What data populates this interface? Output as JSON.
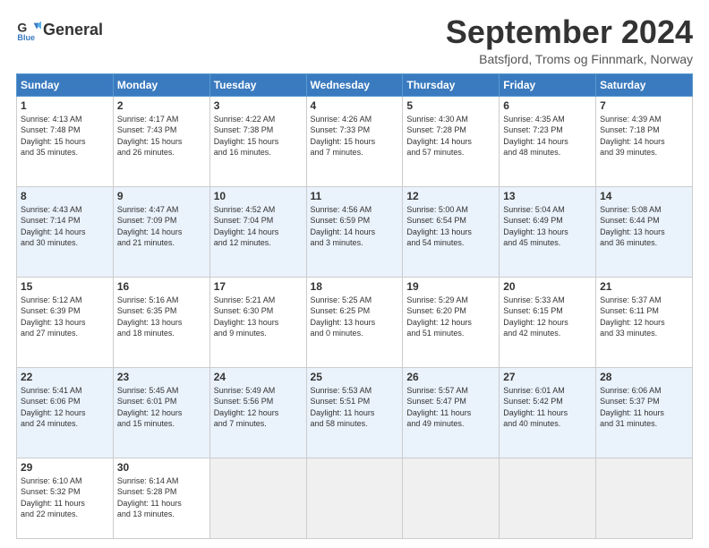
{
  "header": {
    "logo_line1": "General",
    "logo_line2": "Blue",
    "month": "September 2024",
    "location": "Batsfjord, Troms og Finnmark, Norway"
  },
  "days_of_week": [
    "Sunday",
    "Monday",
    "Tuesday",
    "Wednesday",
    "Thursday",
    "Friday",
    "Saturday"
  ],
  "weeks": [
    [
      {
        "day": "1",
        "info": "Sunrise: 4:13 AM\nSunset: 7:48 PM\nDaylight: 15 hours\nand 35 minutes."
      },
      {
        "day": "2",
        "info": "Sunrise: 4:17 AM\nSunset: 7:43 PM\nDaylight: 15 hours\nand 26 minutes."
      },
      {
        "day": "3",
        "info": "Sunrise: 4:22 AM\nSunset: 7:38 PM\nDaylight: 15 hours\nand 16 minutes."
      },
      {
        "day": "4",
        "info": "Sunrise: 4:26 AM\nSunset: 7:33 PM\nDaylight: 15 hours\nand 7 minutes."
      },
      {
        "day": "5",
        "info": "Sunrise: 4:30 AM\nSunset: 7:28 PM\nDaylight: 14 hours\nand 57 minutes."
      },
      {
        "day": "6",
        "info": "Sunrise: 4:35 AM\nSunset: 7:23 PM\nDaylight: 14 hours\nand 48 minutes."
      },
      {
        "day": "7",
        "info": "Sunrise: 4:39 AM\nSunset: 7:18 PM\nDaylight: 14 hours\nand 39 minutes."
      }
    ],
    [
      {
        "day": "8",
        "info": "Sunrise: 4:43 AM\nSunset: 7:14 PM\nDaylight: 14 hours\nand 30 minutes."
      },
      {
        "day": "9",
        "info": "Sunrise: 4:47 AM\nSunset: 7:09 PM\nDaylight: 14 hours\nand 21 minutes."
      },
      {
        "day": "10",
        "info": "Sunrise: 4:52 AM\nSunset: 7:04 PM\nDaylight: 14 hours\nand 12 minutes."
      },
      {
        "day": "11",
        "info": "Sunrise: 4:56 AM\nSunset: 6:59 PM\nDaylight: 14 hours\nand 3 minutes."
      },
      {
        "day": "12",
        "info": "Sunrise: 5:00 AM\nSunset: 6:54 PM\nDaylight: 13 hours\nand 54 minutes."
      },
      {
        "day": "13",
        "info": "Sunrise: 5:04 AM\nSunset: 6:49 PM\nDaylight: 13 hours\nand 45 minutes."
      },
      {
        "day": "14",
        "info": "Sunrise: 5:08 AM\nSunset: 6:44 PM\nDaylight: 13 hours\nand 36 minutes."
      }
    ],
    [
      {
        "day": "15",
        "info": "Sunrise: 5:12 AM\nSunset: 6:39 PM\nDaylight: 13 hours\nand 27 minutes."
      },
      {
        "day": "16",
        "info": "Sunrise: 5:16 AM\nSunset: 6:35 PM\nDaylight: 13 hours\nand 18 minutes."
      },
      {
        "day": "17",
        "info": "Sunrise: 5:21 AM\nSunset: 6:30 PM\nDaylight: 13 hours\nand 9 minutes."
      },
      {
        "day": "18",
        "info": "Sunrise: 5:25 AM\nSunset: 6:25 PM\nDaylight: 13 hours\nand 0 minutes."
      },
      {
        "day": "19",
        "info": "Sunrise: 5:29 AM\nSunset: 6:20 PM\nDaylight: 12 hours\nand 51 minutes."
      },
      {
        "day": "20",
        "info": "Sunrise: 5:33 AM\nSunset: 6:15 PM\nDaylight: 12 hours\nand 42 minutes."
      },
      {
        "day": "21",
        "info": "Sunrise: 5:37 AM\nSunset: 6:11 PM\nDaylight: 12 hours\nand 33 minutes."
      }
    ],
    [
      {
        "day": "22",
        "info": "Sunrise: 5:41 AM\nSunset: 6:06 PM\nDaylight: 12 hours\nand 24 minutes."
      },
      {
        "day": "23",
        "info": "Sunrise: 5:45 AM\nSunset: 6:01 PM\nDaylight: 12 hours\nand 15 minutes."
      },
      {
        "day": "24",
        "info": "Sunrise: 5:49 AM\nSunset: 5:56 PM\nDaylight: 12 hours\nand 7 minutes."
      },
      {
        "day": "25",
        "info": "Sunrise: 5:53 AM\nSunset: 5:51 PM\nDaylight: 11 hours\nand 58 minutes."
      },
      {
        "day": "26",
        "info": "Sunrise: 5:57 AM\nSunset: 5:47 PM\nDaylight: 11 hours\nand 49 minutes."
      },
      {
        "day": "27",
        "info": "Sunrise: 6:01 AM\nSunset: 5:42 PM\nDaylight: 11 hours\nand 40 minutes."
      },
      {
        "day": "28",
        "info": "Sunrise: 6:06 AM\nSunset: 5:37 PM\nDaylight: 11 hours\nand 31 minutes."
      }
    ],
    [
      {
        "day": "29",
        "info": "Sunrise: 6:10 AM\nSunset: 5:32 PM\nDaylight: 11 hours\nand 22 minutes."
      },
      {
        "day": "30",
        "info": "Sunrise: 6:14 AM\nSunset: 5:28 PM\nDaylight: 11 hours\nand 13 minutes."
      },
      {
        "day": "",
        "info": ""
      },
      {
        "day": "",
        "info": ""
      },
      {
        "day": "",
        "info": ""
      },
      {
        "day": "",
        "info": ""
      },
      {
        "day": "",
        "info": ""
      }
    ]
  ]
}
